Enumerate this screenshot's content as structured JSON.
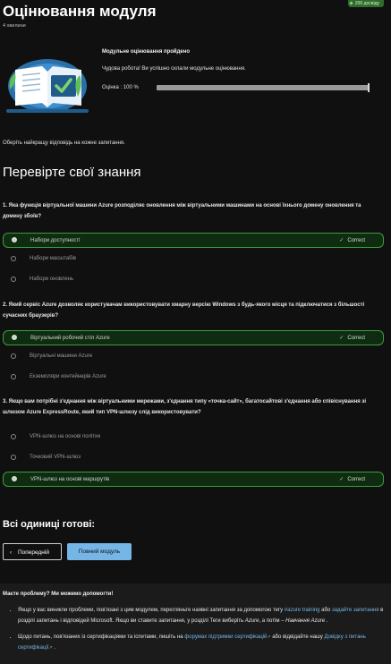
{
  "header": {
    "title": "Оцінювання модуля",
    "duration": "4 хвилини",
    "xp_badge": "200 досвіду"
  },
  "result": {
    "heading": "Модульне оцінювання пройдено",
    "message": "Чудова робота! Ви успішно склали модульне оцінювання.",
    "score_label": "Оцінка : 100 %",
    "score_value": 100
  },
  "instruction": "Оберіть найкращу відповідь на кожне запитання.",
  "section_title": "Перевірте свої знання",
  "questions": [
    {
      "text": "1. Яка функція віртуальної машини Azure розподіляє оновлення між віртуальними машинами на основі їхнього домену оновлення та домену збоїв?",
      "options": [
        "Набори доступності",
        "Набори масштабів",
        "Набори оновлень"
      ],
      "correct_index": 0
    },
    {
      "text": "2. Який сервіс Azure дозволяє користувачам використовувати хмарну версію Windows з будь-якого місця та підключатися з більшості сучасних браузерів?",
      "options": [
        "Віртуальний робочий стіл Azure",
        "Віртуальні машини Azure",
        "Екземпляри контейнерів Azure"
      ],
      "correct_index": 0
    },
    {
      "text": "3. Якщо вам потрібні з'єднання між віртуальними мережами, з'єднання типу «точка-сайт», багатосайтові з'єднання або співіснування зі шлюзом Azure ExpressRoute, який тип VPN-шлюзу слід використовувати?",
      "options": [
        "VPN-шлюз на основі політик",
        "Точковий VPN-шлюз",
        "VPN-шлюз на основі маршрутів"
      ],
      "correct_index": 2
    }
  ],
  "correct_label": "Correct",
  "footer": {
    "units_done": "Всі одиниці готові:",
    "prev_button": "Попередній",
    "full_module_button": "Повний модуль"
  },
  "help": {
    "title": "Маєте проблему? Ми можемо допомогти!",
    "item1_a": "Якщо у вас виникли проблеми, пов'язані з цим модулем, перегляньте наявні запитання за допомогою тегу ",
    "item1_tag": "#azure training",
    "item1_b": " або ",
    "item1_link": "задайте запитання",
    "item1_c": " в розділі запитань і відповідей Microsoft. Якщо ви ставите запитання, у розділі Теги виберіть ",
    "item1_d": "Azure",
    "item1_e": ", а потім – ",
    "item1_f": "Навчання Azure",
    "item1_g": " .",
    "item2_a": "Щодо питань, пов'язаних із сертифікаціями та іспитами, пишіть на ",
    "item2_link": "форумах підтримки сертифікацій",
    "item2_b": " або відвідайте нашу ",
    "item2_link2": "Довідку з питань сертифікації",
    "item2_c": " ."
  },
  "colors": {
    "correct_border": "#3d9c3a",
    "correct_bg": "#0f2c12",
    "primary_button": "#75b6e7",
    "link": "#75b6e7"
  },
  "icons": [
    "check-icon",
    "chevron-left-icon",
    "external-link-icon",
    "book-checkmark-illustration"
  ]
}
